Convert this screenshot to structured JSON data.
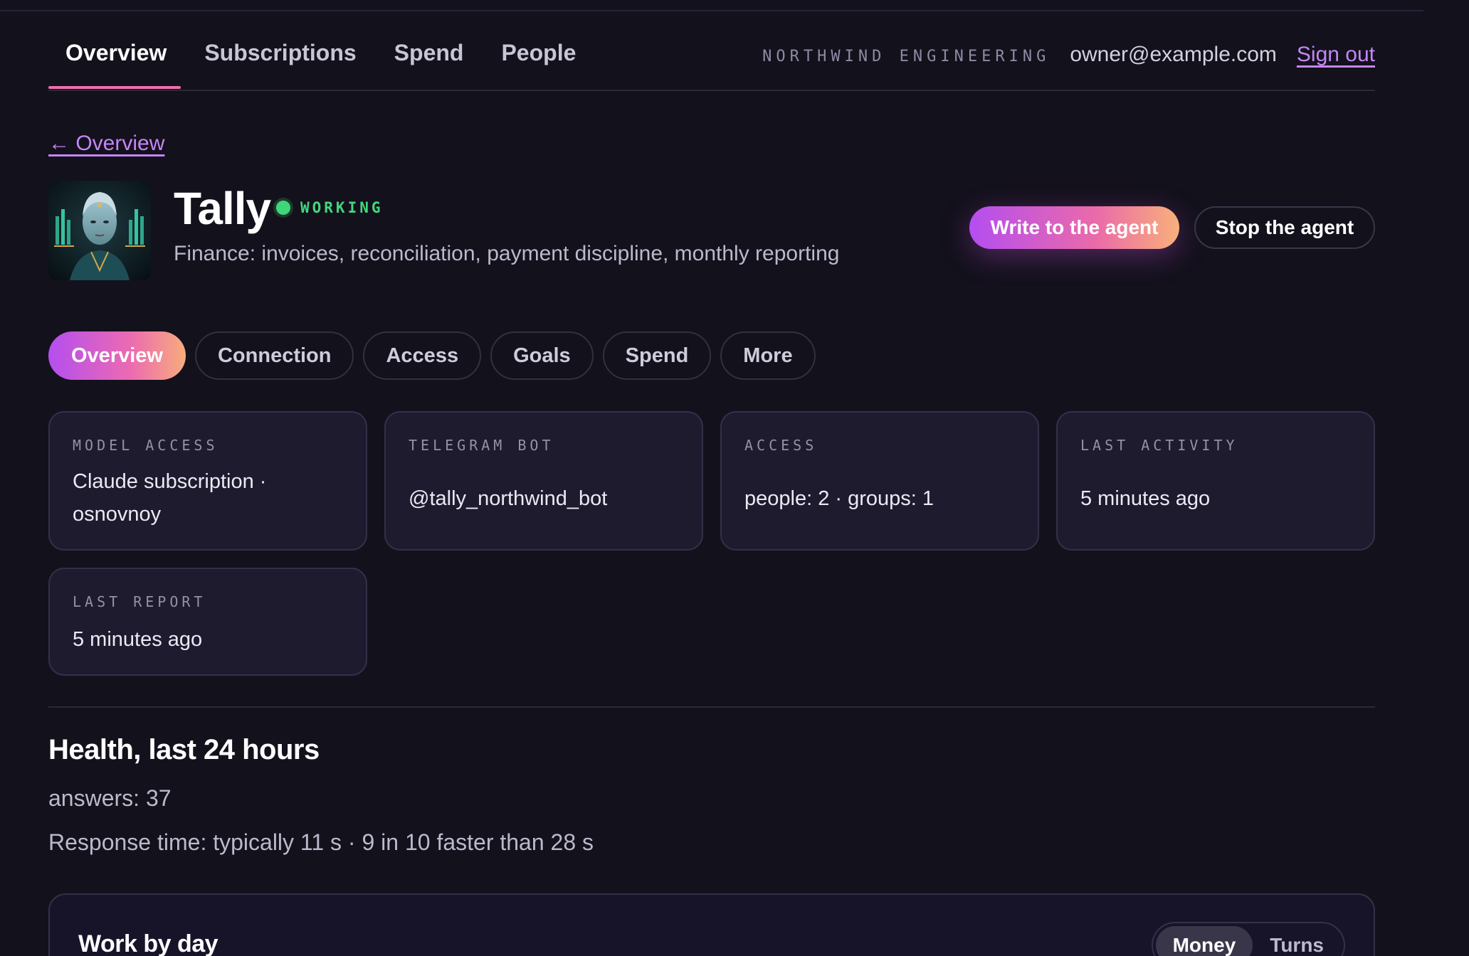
{
  "nav": {
    "tabs": [
      {
        "label": "Overview",
        "active": true
      },
      {
        "label": "Subscriptions",
        "active": false
      },
      {
        "label": "Spend",
        "active": false
      },
      {
        "label": "People",
        "active": false
      }
    ],
    "org": "NORTHWIND ENGINEERING",
    "email": "owner@example.com",
    "sign_out": "Sign out"
  },
  "back_link": "← Overview",
  "agent": {
    "name": "Tally",
    "status": "WORKING",
    "status_color": "#43d67e",
    "description": "Finance: invoices, reconciliation, payment discipline, monthly reporting"
  },
  "actions": {
    "write": "Write to the agent",
    "stop": "Stop the agent"
  },
  "section_tabs": [
    {
      "label": "Overview",
      "active": true
    },
    {
      "label": "Connection",
      "active": false
    },
    {
      "label": "Access",
      "active": false
    },
    {
      "label": "Goals",
      "active": false
    },
    {
      "label": "Spend",
      "active": false
    },
    {
      "label": "More",
      "active": false
    }
  ],
  "cards": [
    {
      "label": "MODEL ACCESS",
      "value": "Claude subscription · osnovnoy"
    },
    {
      "label": "TELEGRAM BOT",
      "value": "@tally_northwind_bot"
    },
    {
      "label": "ACCESS",
      "value": "people: 2 · groups: 1"
    },
    {
      "label": "LAST ACTIVITY",
      "value": "5 minutes ago"
    },
    {
      "label": "LAST REPORT",
      "value": "5 minutes ago"
    }
  ],
  "health": {
    "title": "Health, last 24 hours",
    "answers": "answers: 37",
    "response_time": "Response time: typically 11 s · 9 in 10 faster than 28 s"
  },
  "work_by_day": {
    "title": "Work by day",
    "toggle": [
      {
        "label": "Money",
        "active": true
      },
      {
        "label": "Turns",
        "active": false
      }
    ]
  },
  "colors": {
    "background": "#13111c",
    "accent_link": "#c486f5",
    "accent_gradient": [
      "#b44ef0",
      "#ea6aa9",
      "#f8b07a"
    ],
    "tab_underline": "#f06ea8"
  }
}
